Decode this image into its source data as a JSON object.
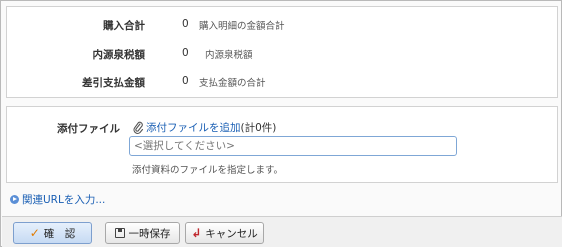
{
  "totals": {
    "purchase_total": {
      "label": "購入合計",
      "value": "0",
      "note": "購入明細の金額合計"
    },
    "withholding_tax": {
      "label": "内源泉税額",
      "value": "0",
      "note": "内源泉税額"
    },
    "net_payment": {
      "label": "差引支払金額",
      "value": "0",
      "note": "支払金額の合計"
    }
  },
  "attachment": {
    "label": "添付ファイル",
    "add_link": "添付ファイルを追加",
    "count": "(計0件)",
    "placeholder": "<選択してください>",
    "hint": "添付資料のファイルを指定します。"
  },
  "related_url": {
    "label": "関連URLを入力..."
  },
  "buttons": {
    "confirm": "確　認",
    "save_draft": "一時保存",
    "cancel": "キャンセル"
  },
  "colors": {
    "link": "#1a5fb4",
    "confirm_bg": "#c6daf3",
    "check_icon": "#e07b00",
    "cancel_icon": "#c0272d"
  },
  "icons": {
    "attach": "paperclip-icon",
    "url": "arrow-circle-icon",
    "confirm": "checkmark-icon",
    "save": "floppy-disk-icon",
    "cancel": "return-arrow-icon"
  }
}
